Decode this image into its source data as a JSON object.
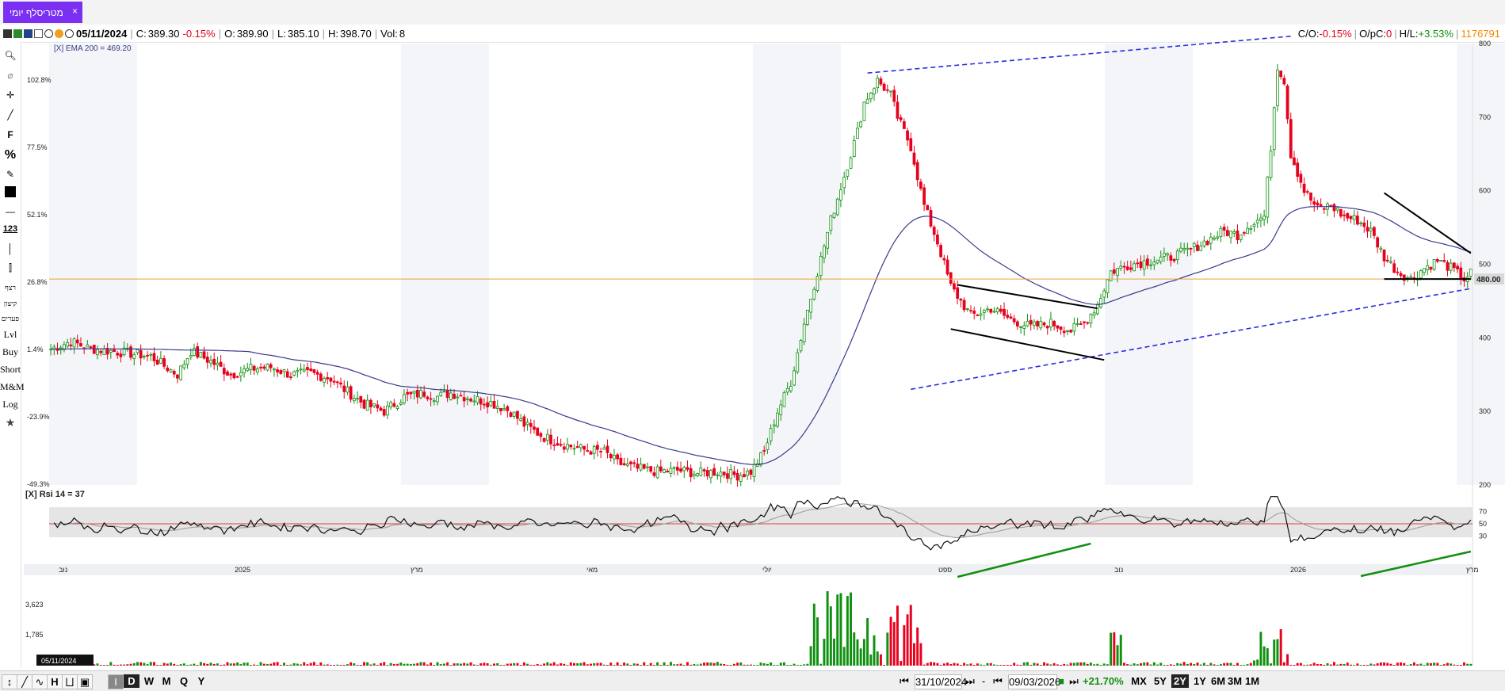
{
  "tab": {
    "title": "מטריסלף יומי",
    "close": "×"
  },
  "info": {
    "date": "05/11/2024",
    "close_label": "C:",
    "close": "389.30",
    "close_chg": "-0.15%",
    "open_label": "O:",
    "open": "389.90",
    "low_label": "L:",
    "low": "385.10",
    "high_label": "H:",
    "high": "398.70",
    "vol_label": "Vol:",
    "vol": "8",
    "co_label": "C/O:",
    "co": "-0.15%",
    "opc_label": "O/pC:",
    "opc": "0",
    "hl_label": "H/L:",
    "hl": "+3.53%",
    "volume_total": "1176791"
  },
  "left_toolbar": {
    "t1": "רצף",
    "t2": "קיצון",
    "t3": "פערים",
    "lvl": "Lvl",
    "buy": "Buy",
    "short": "Short",
    "mm": "M&M",
    "log": "Log"
  },
  "bottom": {
    "from_date": "31/10/2024",
    "to_date": "09/03/2026",
    "change": "+21.70%",
    "periods": [
      "MX",
      "5Y",
      "2Y",
      "1Y",
      "6M",
      "3M",
      "1M"
    ],
    "selected_period": "2Y",
    "intervals": [
      "D",
      "W",
      "M",
      "Q",
      "Y"
    ],
    "selected_interval": "D",
    "dash": "-"
  },
  "colors": {
    "up": "#109010",
    "down": "#e8001c",
    "ema": "#3a3a8c",
    "trend": "#2a2ae0",
    "rsi": "#111111",
    "rsi_signal": "#999999",
    "level": "#e8a040",
    "accent": "#7b2ff2"
  },
  "chart_data": [
    {
      "type": "candlestick",
      "name": "price",
      "ema_label": "[X] EMA 200 = 469.20",
      "pct_ticks": [
        "102.8%",
        "77.5%",
        "52.1%",
        "26.8%",
        "1.4%",
        "-23.9%",
        "-49.3%"
      ],
      "price_ticks": [
        "800",
        "700",
        "600",
        "500",
        "400",
        "300",
        "200"
      ],
      "price_tick_values": [
        800,
        700,
        600,
        500,
        400,
        300,
        200
      ],
      "level_label": "480.00",
      "level_value": 480,
      "x_labels": [
        "נוב",
        "2025",
        "מרץ",
        "מאי",
        "יולי",
        "ספט",
        "נוב",
        "2026",
        "מרץ"
      ],
      "ylim": [
        200,
        800
      ],
      "anchors": [
        [
          0,
          385
        ],
        [
          6,
          395
        ],
        [
          12,
          385
        ],
        [
          22,
          380
        ],
        [
          30,
          375
        ],
        [
          34,
          362
        ],
        [
          38,
          350
        ],
        [
          42,
          382
        ],
        [
          48,
          368
        ],
        [
          54,
          350
        ],
        [
          60,
          358
        ],
        [
          66,
          360
        ],
        [
          72,
          350
        ],
        [
          78,
          352
        ],
        [
          84,
          345
        ],
        [
          88,
          330
        ],
        [
          94,
          310
        ],
        [
          100,
          300
        ],
        [
          106,
          320
        ],
        [
          112,
          325
        ],
        [
          116,
          320
        ],
        [
          120,
          325
        ],
        [
          126,
          318
        ],
        [
          132,
          312
        ],
        [
          138,
          300
        ],
        [
          142,
          282
        ],
        [
          148,
          265
        ],
        [
          154,
          255
        ],
        [
          160,
          248
        ],
        [
          166,
          245
        ],
        [
          170,
          230
        ],
        [
          176,
          222
        ],
        [
          182,
          218
        ],
        [
          188,
          220
        ],
        [
          194,
          216
        ],
        [
          200,
          218
        ],
        [
          206,
          213
        ],
        [
          210,
          218
        ],
        [
          214,
          245
        ],
        [
          218,
          300
        ],
        [
          222,
          340
        ],
        [
          226,
          420
        ],
        [
          230,
          490
        ],
        [
          234,
          560
        ],
        [
          238,
          620
        ],
        [
          242,
          680
        ],
        [
          244,
          720
        ],
        [
          248,
          750
        ],
        [
          252,
          730
        ],
        [
          254,
          700
        ],
        [
          258,
          660
        ],
        [
          262,
          580
        ],
        [
          266,
          530
        ],
        [
          270,
          470
        ],
        [
          276,
          430
        ],
        [
          282,
          440
        ],
        [
          288,
          425
        ],
        [
          294,
          415
        ],
        [
          300,
          420
        ],
        [
          306,
          410
        ],
        [
          310,
          420
        ],
        [
          314,
          445
        ],
        [
          318,
          490
        ],
        [
          324,
          500
        ],
        [
          330,
          505
        ],
        [
          336,
          510
        ],
        [
          342,
          520
        ],
        [
          348,
          535
        ],
        [
          352,
          545
        ],
        [
          356,
          540
        ],
        [
          360,
          555
        ],
        [
          364,
          565
        ],
        [
          366,
          660
        ],
        [
          368,
          770
        ],
        [
          370,
          750
        ],
        [
          372,
          650
        ],
        [
          376,
          600
        ],
        [
          380,
          575
        ],
        [
          384,
          580
        ],
        [
          388,
          565
        ],
        [
          392,
          560
        ],
        [
          396,
          545
        ],
        [
          400,
          510
        ],
        [
          404,
          490
        ],
        [
          408,
          480
        ],
        [
          412,
          495
        ],
        [
          416,
          505
        ],
        [
          420,
          495
        ],
        [
          424,
          480
        ],
        [
          426,
          488
        ]
      ],
      "n_bars": 427
    },
    {
      "type": "line",
      "name": "rsi",
      "label": "[X] Rsi 14 = 37",
      "ticks": [
        "70",
        "50",
        "30"
      ],
      "tick_values": [
        70,
        50,
        30
      ],
      "ylim": [
        0,
        100
      ],
      "mid_line": 50
    },
    {
      "type": "bar",
      "name": "volume",
      "ticks": [
        "3,623",
        "1,785"
      ],
      "tick_values": [
        3623,
        1785
      ],
      "bottom_date_label": "05/11/2024"
    }
  ]
}
